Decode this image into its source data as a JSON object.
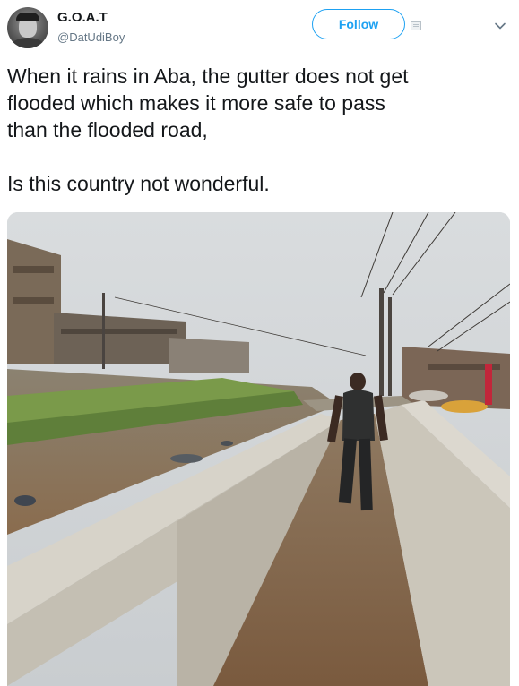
{
  "tweet": {
    "author": {
      "display_name": "G.O.A.T",
      "handle": "@DatUdiBoy",
      "avatar_icon": "avatar-photo"
    },
    "follow_label": "Follow",
    "menu_icon": "chevron-down-icon",
    "text_lines": [
      "When it rains in Aba, the gutter does not get",
      "flooded which makes it more safe to pass",
      "than the flooded road,"
    ],
    "text_line_last": "Is this country not wonderful.",
    "media": {
      "type": "photo",
      "subject": "man walking along a concrete gutter beside a flooded road"
    }
  },
  "colors": {
    "accent": "#1da1f2",
    "text": "#14171a",
    "secondary_text": "#657786"
  }
}
